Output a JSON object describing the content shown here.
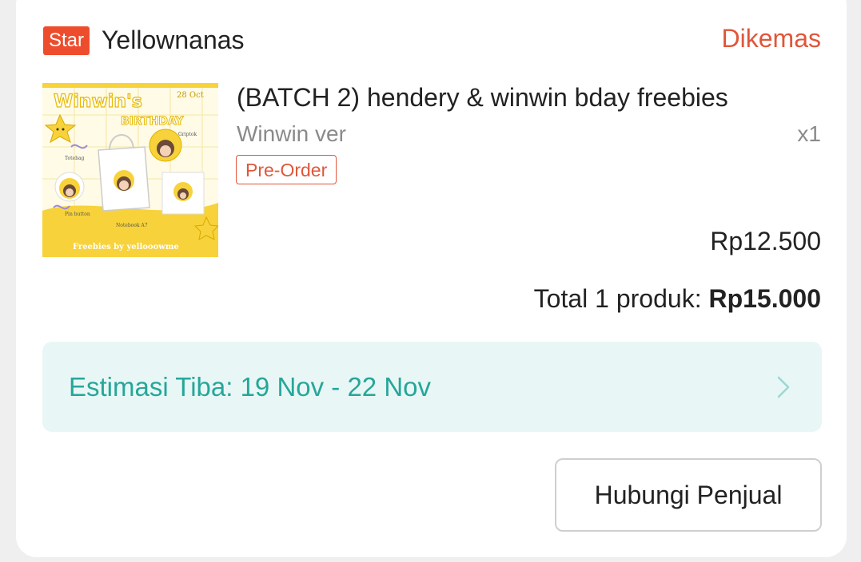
{
  "shop": {
    "badge": "Star",
    "name": "Yellownanas",
    "status": "Dikemas"
  },
  "product": {
    "image": {
      "title": "Winwin's",
      "subtitle": "BIRTHDAY",
      "date": "28 Oct",
      "labels": [
        "Griptok",
        "Totebag",
        "Pin button",
        "Notebook A7"
      ],
      "footer": "Freebies by yellooowme"
    },
    "title": "(BATCH 2) hendery & winwin bday freebies",
    "variant": "Winwin ver",
    "quantity": "x1",
    "tag": "Pre-Order",
    "price": "Rp12.500"
  },
  "summary": {
    "label": "Total 1 produk: ",
    "amount": "Rp15.000"
  },
  "delivery": {
    "estimate": "Estimasi Tiba: 19 Nov - 22 Nov"
  },
  "actions": {
    "contact_seller": "Hubungi Penjual"
  },
  "colors": {
    "accent": "#ee4d2d",
    "status": "#e0563a",
    "eta_text": "#26a69a",
    "eta_bg": "#e8f7f5"
  }
}
